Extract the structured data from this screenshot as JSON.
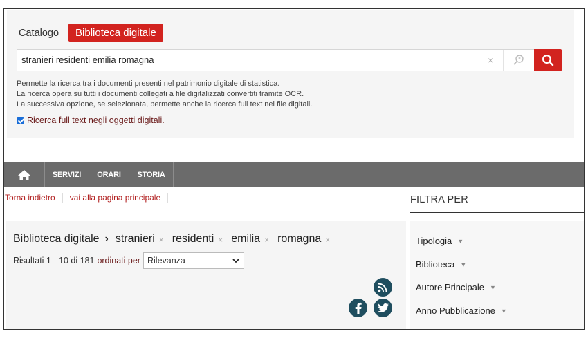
{
  "search": {
    "tabs": {
      "catalog": "Catalogo",
      "digital": "Biblioteca digitale"
    },
    "query": "stranieri residenti emilia romagna",
    "clear": "×",
    "help": [
      "Permette la ricerca tra i documenti presenti nel patrimonio digitale di statistica.",
      "La ricerca opera su tutti i documenti collegati a file digitalizzati convertiti tramite OCR.",
      "La successiva opzione, se selezionata, permette anche la ricerca full text nei file digitali."
    ],
    "fulltext_label": "Ricerca full text negli oggetti digitali.",
    "fulltext_checked": true,
    "accent_color": "#d2231f"
  },
  "nav": {
    "home_icon": "home-icon",
    "servizi": "SERVIZI",
    "orari": "ORARI",
    "storia": "STORIA"
  },
  "breadcrumb": {
    "back": "Torna indietro",
    "home": "vai alla pagina principale"
  },
  "results": {
    "root": "Biblioteca digitale",
    "terms": [
      "stranieri",
      "residenti",
      "emilia",
      "romagna"
    ],
    "term_remove": "×",
    "count_text": "Risultati 1 - 10 di 181",
    "sorted_label": "ordinati per",
    "sort_value": "Rilevanza",
    "social_icons": [
      "rss-icon",
      "facebook-icon",
      "twitter-icon"
    ]
  },
  "filters": {
    "title": "FILTRA PER",
    "facets": [
      "Tipologia",
      "Biblioteca",
      "Autore Principale",
      "Anno Pubblicazione"
    ],
    "arrow": "▼"
  }
}
